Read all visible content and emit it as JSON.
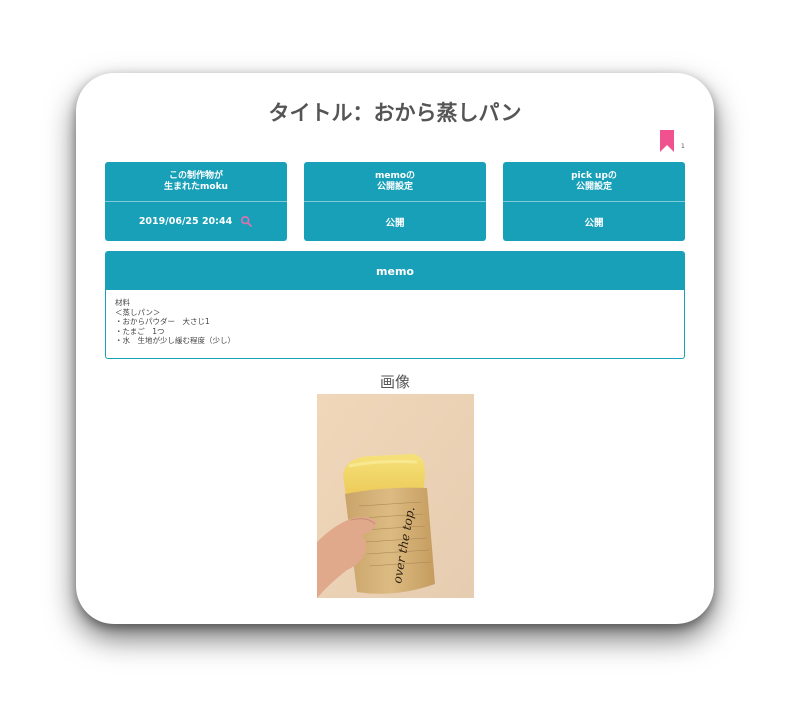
{
  "page": {
    "title": "タイトル：おから蒸しパン",
    "bookmark_count": "1"
  },
  "panels": [
    {
      "head_line1": "この制作物が",
      "head_line2": "生まれたmoku",
      "value": "2019/06/25 20:44",
      "icon": "search-icon"
    },
    {
      "head_line1": "memoの",
      "head_line2": "公開設定",
      "value": "公開"
    },
    {
      "head_line1": "pick upの",
      "head_line2": "公開設定",
      "value": "公開"
    }
  ],
  "memo": {
    "heading": "memo",
    "lines": [
      "材料",
      "＜蒸しパン＞",
      "・おからパウダー　大さじ1",
      "・たまご　1つ",
      "・水　生地が少し緩む程度（少し）"
    ]
  },
  "image_section": {
    "label": "画像",
    "wrapper_text": "over the top."
  },
  "colors": {
    "accent": "#18a0b8",
    "bookmark": "#f0518f",
    "search_icon": "#e26fb1",
    "title_text": "#555555"
  }
}
